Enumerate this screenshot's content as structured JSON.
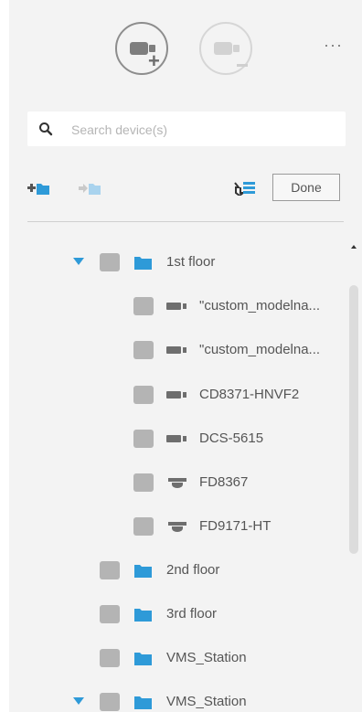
{
  "toolbar_top": {
    "add_camera_icon": "camera-add-icon",
    "remove_camera_icon": "camera-remove-icon",
    "more_label": "···"
  },
  "search": {
    "placeholder": "Search device(s)",
    "value": ""
  },
  "actions": {
    "add_folder_icon": "folder-add-icon",
    "move_folder_icon": "folder-move-icon",
    "sort_icon": "list-sort-icon",
    "done_label": "Done"
  },
  "tree": {
    "rows": [
      {
        "label": "1st floor",
        "type": "folder",
        "expanded": true
      },
      {
        "label": "\"custom_modelna...",
        "type": "camera-bullet"
      },
      {
        "label": "\"custom_modelna...",
        "type": "camera-bullet"
      },
      {
        "label": "CD8371-HNVF2",
        "type": "camera-bullet"
      },
      {
        "label": "DCS-5615",
        "type": "camera-bullet"
      },
      {
        "label": "FD8367",
        "type": "camera-dome"
      },
      {
        "label": "FD9171-HT",
        "type": "camera-dome"
      },
      {
        "label": "2nd floor",
        "type": "folder"
      },
      {
        "label": "3rd floor",
        "type": "folder"
      },
      {
        "label": "VMS_Station",
        "type": "folder"
      },
      {
        "label": "VMS_Station",
        "type": "folder",
        "expanded": true
      }
    ]
  },
  "colors": {
    "panel_bg": "#f3f3f3",
    "accent": "#2e9ad8",
    "checkbox": "#b4b4b4",
    "icon_gray": "#6e6e6e"
  }
}
